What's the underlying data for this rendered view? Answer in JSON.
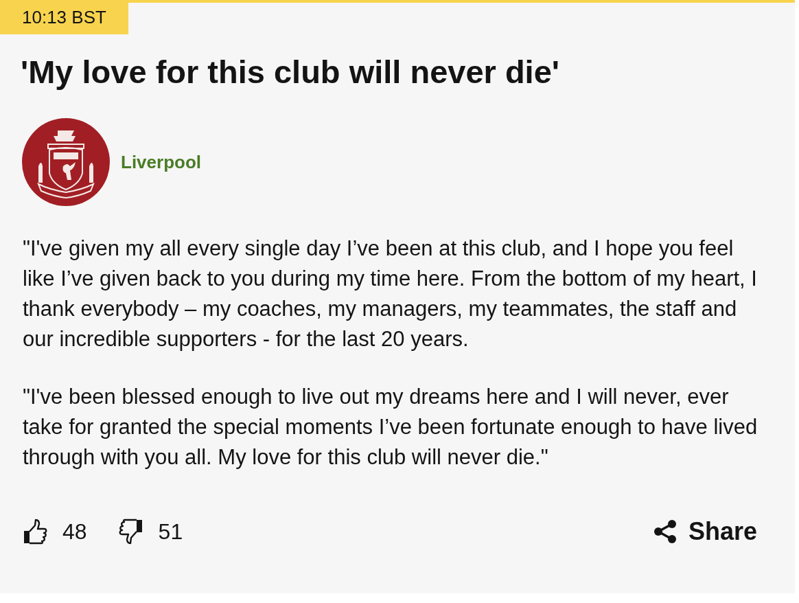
{
  "post": {
    "time": "10:13 BST",
    "title": "'My love for this club will never die'",
    "author": {
      "name": "Liverpool"
    },
    "paragraphs": [
      "\"I've given my all every single day I’ve been at this club, and I hope you feel like I’ve given back to you during my time here. From the bottom of my heart, I thank everybody – my coaches, my managers, my teammates, the staff and our incredible supporters - for the last 20 years.",
      "\"I've been blessed enough to live out my dreams here and I will never, ever take for granted the special moments I’ve been fortunate enough to have lived through with you all. My love for this club will never die.\""
    ],
    "reactions": {
      "likes": "48",
      "dislikes": "51"
    },
    "share": {
      "label": "Share"
    }
  }
}
